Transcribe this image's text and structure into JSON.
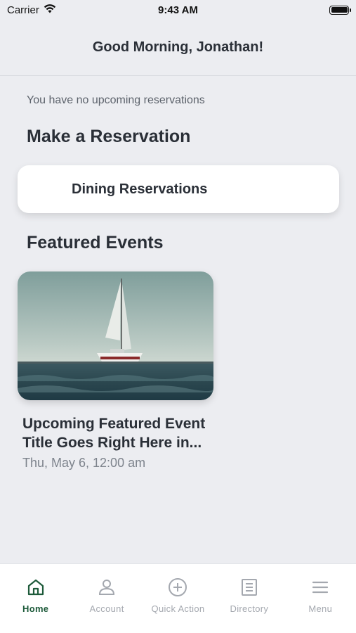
{
  "status_bar": {
    "carrier": "Carrier",
    "time": "9:43 AM"
  },
  "header": {
    "greeting": "Good Morning, Jonathan!"
  },
  "reservations": {
    "empty_message": "You have no upcoming reservations"
  },
  "make_reservation": {
    "title": "Make a Reservation",
    "options": [
      {
        "label": "Dining Reservations"
      }
    ]
  },
  "featured_events": {
    "title": "Featured Events",
    "events": [
      {
        "title": "Upcoming Featured Event Title Goes  Right Here in...",
        "date": "Thu, May 6, 12:00 am",
        "image": "sailboat-photo"
      }
    ]
  },
  "tab_bar": {
    "active_tab": "Home",
    "accent_color": "#1d5a3a",
    "inactive_color": "#a4a8af",
    "tabs": [
      {
        "label": "Home",
        "icon": "home-icon"
      },
      {
        "label": "Account",
        "icon": "person-icon"
      },
      {
        "label": "Quick Action",
        "icon": "plus-circle-icon"
      },
      {
        "label": "Directory",
        "icon": "directory-icon"
      },
      {
        "label": "Menu",
        "icon": "hamburger-menu-icon"
      }
    ]
  }
}
